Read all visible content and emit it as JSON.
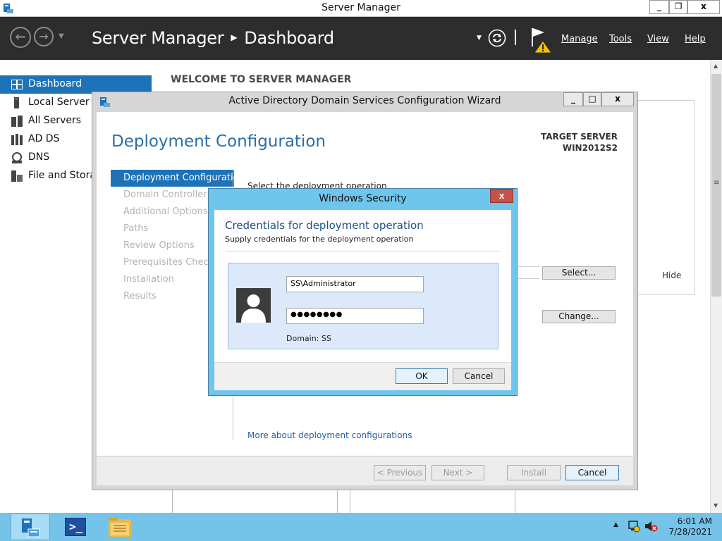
{
  "window": {
    "title": "Server Manager",
    "controls": [
      "_",
      "❐",
      "x"
    ]
  },
  "header": {
    "app_name": "Server Manager",
    "page": "Dashboard",
    "menu": [
      "Manage",
      "Tools",
      "View",
      "Help"
    ]
  },
  "sidebar": {
    "items": [
      {
        "label": "Dashboard",
        "icon": "dashboard-icon",
        "selected": true
      },
      {
        "label": "Local Server",
        "icon": "server-icon",
        "selected": false
      },
      {
        "label": "All Servers",
        "icon": "servers-icon",
        "selected": false
      },
      {
        "label": "AD DS",
        "icon": "adds-icon",
        "selected": false
      },
      {
        "label": "DNS",
        "icon": "dns-icon",
        "selected": false
      },
      {
        "label": "File and Storag",
        "icon": "storage-icon",
        "selected": false
      }
    ]
  },
  "main": {
    "welcome": "WELCOME TO SERVER MANAGER",
    "hide": "Hide"
  },
  "wizard": {
    "title": "Active Directory Domain Services Configuration Wizard",
    "heading": "Deployment Configuration",
    "target_label": "TARGET SERVER",
    "target_name": "WIN2012S2",
    "steps": [
      "Deployment Configuration",
      "Domain Controller Op",
      "Additional Options",
      "Paths",
      "Review Options",
      "Prerequisites Check",
      "Installation",
      "Results"
    ],
    "instruction": "Select the deployment operation",
    "select_btn": "Select...",
    "change_btn": "Change...",
    "more_link": "More about deployment configurations",
    "buttons": {
      "previous": "< Previous",
      "next": "Next >",
      "install": "Install",
      "cancel": "Cancel"
    }
  },
  "security": {
    "title": "Windows Security",
    "heading": "Credentials for deployment operation",
    "subheading": "Supply credentials for the deployment operation",
    "username": "SS\\Administrator",
    "password": "●●●●●●●●",
    "domain": "Domain: SS",
    "ok": "OK",
    "cancel": "Cancel"
  },
  "taskbar": {
    "time": "6:01 AM",
    "date": "7/28/2021"
  },
  "colors": {
    "header_bg": "#2d2d2d",
    "selection_blue": "#1e73b8",
    "dialog_frame": "#6ec6ec",
    "taskbar": "#74c4ea",
    "link": "#1e5fa8"
  }
}
